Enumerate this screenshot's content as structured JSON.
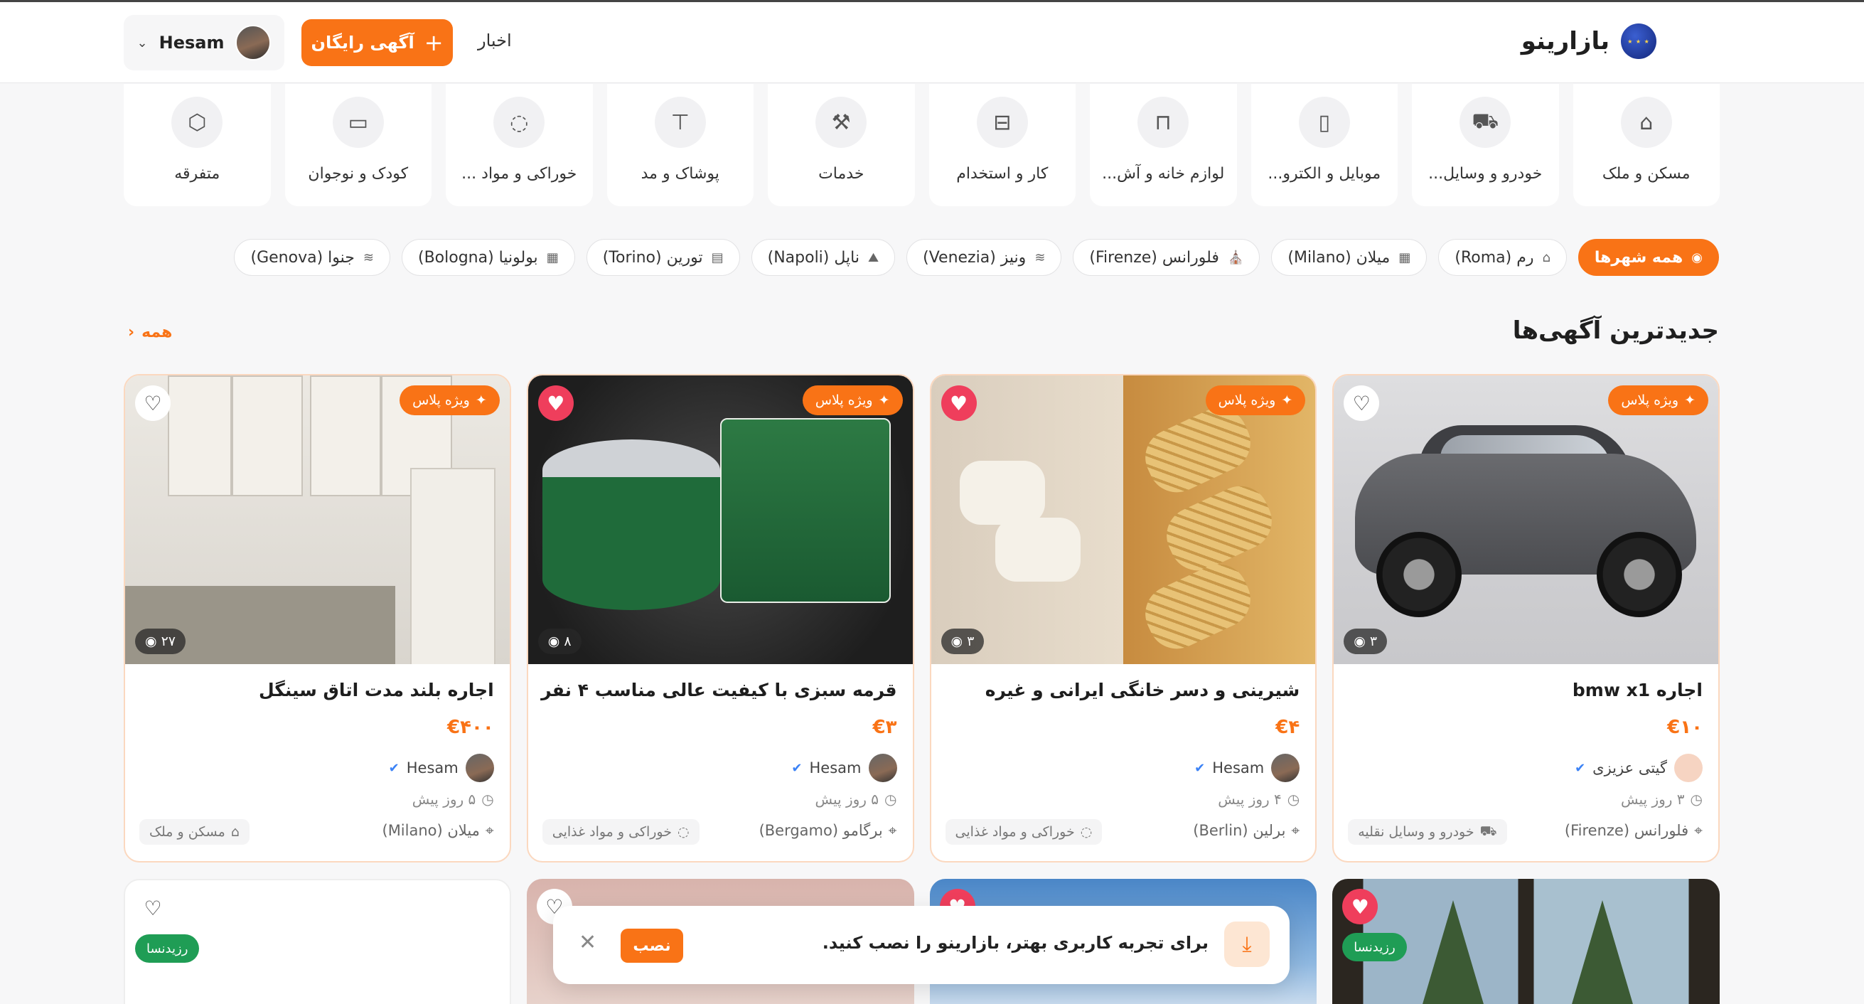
{
  "brand": {
    "name": "بازارینو"
  },
  "header": {
    "news_label": "اخبار",
    "post_button": "آگهی رایگان",
    "user_name": "Hesam"
  },
  "categories": [
    {
      "label": "مسکن و ملک",
      "icon": "home-icon",
      "glyph": "⌂"
    },
    {
      "label": "خودرو و وسایل...",
      "icon": "car-icon",
      "glyph": "🚗"
    },
    {
      "label": "موبایل و الکترو...",
      "icon": "mobile-icon",
      "glyph": "▯"
    },
    {
      "label": "لوازم خانه و آش...",
      "icon": "sofa-icon",
      "glyph": "⊓"
    },
    {
      "label": "کار و استخدام",
      "icon": "briefcase-icon",
      "glyph": "⊟"
    },
    {
      "label": "خدمات",
      "icon": "wrench-icon",
      "glyph": "⚒"
    },
    {
      "label": "پوشاک و مد",
      "icon": "shirt-icon",
      "glyph": "⊤"
    },
    {
      "label": "خوراکی و مواد ...",
      "icon": "apple-icon",
      "glyph": "◌"
    },
    {
      "label": "کودک و نوجوان",
      "icon": "toy-icon",
      "glyph": "▭"
    },
    {
      "label": "متفرقه",
      "icon": "box-icon",
      "glyph": "⬡"
    }
  ],
  "cities": [
    {
      "label": "همه شهرها",
      "icon": "pin-icon",
      "glyph": "◉",
      "active": true
    },
    {
      "label": "رم (Roma)",
      "icon": "landmark-icon",
      "glyph": "⌂"
    },
    {
      "label": "میلان (Milano)",
      "icon": "building-icon",
      "glyph": "▦"
    },
    {
      "label": "فلورانس (Firenze)",
      "icon": "church-icon",
      "glyph": "⛪"
    },
    {
      "label": "ونیز (Venezia)",
      "icon": "waves-icon",
      "glyph": "≋"
    },
    {
      "label": "ناپل (Napoli)",
      "icon": "mountain-icon",
      "glyph": "⛰"
    },
    {
      "label": "تورین (Torino)",
      "icon": "castle-icon",
      "glyph": "▤"
    },
    {
      "label": "بولونیا (Bologna)",
      "icon": "tower-icon",
      "glyph": "▦"
    },
    {
      "label": "جنوا (Genova)",
      "icon": "waves-icon",
      "glyph": "≋"
    }
  ],
  "section": {
    "title": "جدیدترین آگهی‌ها",
    "see_all": "همه"
  },
  "listings": [
    {
      "title": "اجاره bmw x1",
      "price": "€۱۰",
      "badge": "ویژه پلاس",
      "views": "۳",
      "seller": "گیتی عزیزی",
      "time": "۳ روز پیش",
      "location": "فلورانس (Firenze)",
      "category": "خودرو و وسایل نقلیه",
      "favorited": false
    },
    {
      "title": "شیرینی و دسر خانگی ایرانی و غیره",
      "price": "€۴",
      "badge": "ویژه پلاس",
      "views": "۳",
      "seller": "Hesam",
      "time": "۴ روز پیش",
      "location": "برلین (Berlin)",
      "category": "خوراکی و مواد غذایی",
      "favorited": true
    },
    {
      "title": "قرمه سبزی با کیفیت عالی مناسب ۴ نفر",
      "price": "€۳",
      "badge": "ویژه پلاس",
      "views": "۸",
      "seller": "Hesam",
      "time": "۵ روز پیش",
      "location": "برگامو (Bergamo)",
      "category": "خوراکی و مواد غذایی",
      "favorited": true
    },
    {
      "title": "اجاره بلند مدت اتاق سینگل",
      "price": "€۴۰۰",
      "badge": "ویژه پلاس",
      "views": "۲۷",
      "seller": "Hesam",
      "time": "۵ روز پیش",
      "location": "میلان (Milano)",
      "category": "مسکن و ملک",
      "favorited": false
    }
  ],
  "row2_badges": {
    "first": "رزیدنسا",
    "last": "رزیدنسا"
  },
  "install_banner": {
    "message": "برای تجربه کاربری بهتر، بازارینو را نصب کنید.",
    "button": "نصب"
  },
  "colors": {
    "accent": "#f97316",
    "favorite": "#ef3e5c",
    "badge_green": "#1f9d55"
  }
}
